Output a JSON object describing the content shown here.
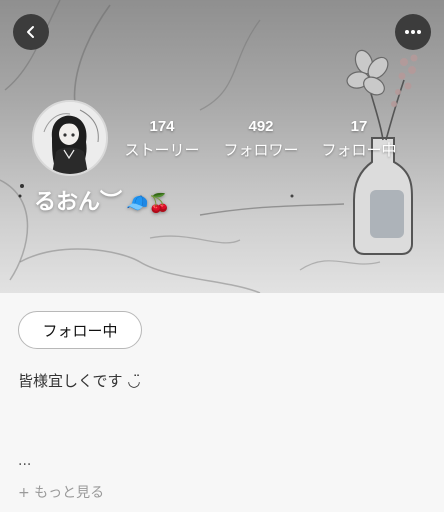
{
  "profile": {
    "username": "るおん︶",
    "username_emoji": "🧢🍒",
    "bio": "皆様宜しくです ◡̈"
  },
  "stats": [
    {
      "count": "174",
      "label": "ストーリー"
    },
    {
      "count": "492",
      "label": "フォロワー"
    },
    {
      "count": "17",
      "label": "フォロー中"
    }
  ],
  "actions": {
    "follow_label": "フォロー中"
  },
  "bio_section": {
    "ellipsis": "...",
    "show_more_label": "+ もっと見る"
  },
  "icons": {
    "back": "chevron-left-icon",
    "more": "more-horizontal-icon"
  },
  "colors": {
    "round_button_bg": "#3c3c3c",
    "button_border": "#b8b8b8",
    "show_more_text": "#9a9a9a"
  }
}
